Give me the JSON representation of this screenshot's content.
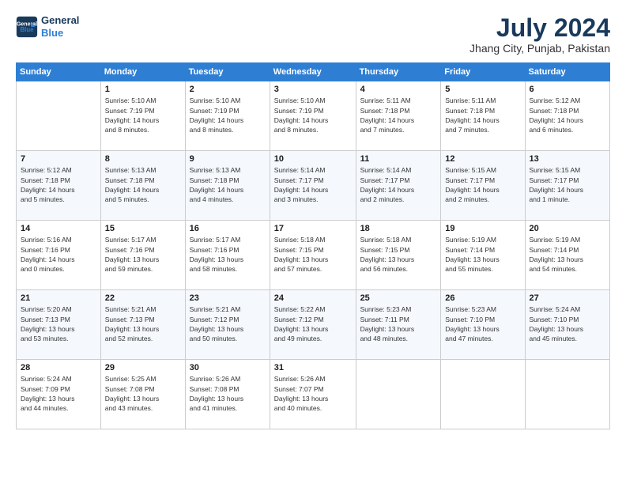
{
  "header": {
    "logo_line1": "General",
    "logo_line2": "Blue",
    "month": "July 2024",
    "location": "Jhang City, Punjab, Pakistan"
  },
  "days_of_week": [
    "Sunday",
    "Monday",
    "Tuesday",
    "Wednesday",
    "Thursday",
    "Friday",
    "Saturday"
  ],
  "weeks": [
    [
      {
        "day": "",
        "info": ""
      },
      {
        "day": "1",
        "info": "Sunrise: 5:10 AM\nSunset: 7:19 PM\nDaylight: 14 hours\nand 8 minutes."
      },
      {
        "day": "2",
        "info": "Sunrise: 5:10 AM\nSunset: 7:19 PM\nDaylight: 14 hours\nand 8 minutes."
      },
      {
        "day": "3",
        "info": "Sunrise: 5:10 AM\nSunset: 7:19 PM\nDaylight: 14 hours\nand 8 minutes."
      },
      {
        "day": "4",
        "info": "Sunrise: 5:11 AM\nSunset: 7:18 PM\nDaylight: 14 hours\nand 7 minutes."
      },
      {
        "day": "5",
        "info": "Sunrise: 5:11 AM\nSunset: 7:18 PM\nDaylight: 14 hours\nand 7 minutes."
      },
      {
        "day": "6",
        "info": "Sunrise: 5:12 AM\nSunset: 7:18 PM\nDaylight: 14 hours\nand 6 minutes."
      }
    ],
    [
      {
        "day": "7",
        "info": "Sunrise: 5:12 AM\nSunset: 7:18 PM\nDaylight: 14 hours\nand 5 minutes."
      },
      {
        "day": "8",
        "info": "Sunrise: 5:13 AM\nSunset: 7:18 PM\nDaylight: 14 hours\nand 5 minutes."
      },
      {
        "day": "9",
        "info": "Sunrise: 5:13 AM\nSunset: 7:18 PM\nDaylight: 14 hours\nand 4 minutes."
      },
      {
        "day": "10",
        "info": "Sunrise: 5:14 AM\nSunset: 7:17 PM\nDaylight: 14 hours\nand 3 minutes."
      },
      {
        "day": "11",
        "info": "Sunrise: 5:14 AM\nSunset: 7:17 PM\nDaylight: 14 hours\nand 2 minutes."
      },
      {
        "day": "12",
        "info": "Sunrise: 5:15 AM\nSunset: 7:17 PM\nDaylight: 14 hours\nand 2 minutes."
      },
      {
        "day": "13",
        "info": "Sunrise: 5:15 AM\nSunset: 7:17 PM\nDaylight: 14 hours\nand 1 minute."
      }
    ],
    [
      {
        "day": "14",
        "info": "Sunrise: 5:16 AM\nSunset: 7:16 PM\nDaylight: 14 hours\nand 0 minutes."
      },
      {
        "day": "15",
        "info": "Sunrise: 5:17 AM\nSunset: 7:16 PM\nDaylight: 13 hours\nand 59 minutes."
      },
      {
        "day": "16",
        "info": "Sunrise: 5:17 AM\nSunset: 7:16 PM\nDaylight: 13 hours\nand 58 minutes."
      },
      {
        "day": "17",
        "info": "Sunrise: 5:18 AM\nSunset: 7:15 PM\nDaylight: 13 hours\nand 57 minutes."
      },
      {
        "day": "18",
        "info": "Sunrise: 5:18 AM\nSunset: 7:15 PM\nDaylight: 13 hours\nand 56 minutes."
      },
      {
        "day": "19",
        "info": "Sunrise: 5:19 AM\nSunset: 7:14 PM\nDaylight: 13 hours\nand 55 minutes."
      },
      {
        "day": "20",
        "info": "Sunrise: 5:19 AM\nSunset: 7:14 PM\nDaylight: 13 hours\nand 54 minutes."
      }
    ],
    [
      {
        "day": "21",
        "info": "Sunrise: 5:20 AM\nSunset: 7:13 PM\nDaylight: 13 hours\nand 53 minutes."
      },
      {
        "day": "22",
        "info": "Sunrise: 5:21 AM\nSunset: 7:13 PM\nDaylight: 13 hours\nand 52 minutes."
      },
      {
        "day": "23",
        "info": "Sunrise: 5:21 AM\nSunset: 7:12 PM\nDaylight: 13 hours\nand 50 minutes."
      },
      {
        "day": "24",
        "info": "Sunrise: 5:22 AM\nSunset: 7:12 PM\nDaylight: 13 hours\nand 49 minutes."
      },
      {
        "day": "25",
        "info": "Sunrise: 5:23 AM\nSunset: 7:11 PM\nDaylight: 13 hours\nand 48 minutes."
      },
      {
        "day": "26",
        "info": "Sunrise: 5:23 AM\nSunset: 7:10 PM\nDaylight: 13 hours\nand 47 minutes."
      },
      {
        "day": "27",
        "info": "Sunrise: 5:24 AM\nSunset: 7:10 PM\nDaylight: 13 hours\nand 45 minutes."
      }
    ],
    [
      {
        "day": "28",
        "info": "Sunrise: 5:24 AM\nSunset: 7:09 PM\nDaylight: 13 hours\nand 44 minutes."
      },
      {
        "day": "29",
        "info": "Sunrise: 5:25 AM\nSunset: 7:08 PM\nDaylight: 13 hours\nand 43 minutes."
      },
      {
        "day": "30",
        "info": "Sunrise: 5:26 AM\nSunset: 7:08 PM\nDaylight: 13 hours\nand 41 minutes."
      },
      {
        "day": "31",
        "info": "Sunrise: 5:26 AM\nSunset: 7:07 PM\nDaylight: 13 hours\nand 40 minutes."
      },
      {
        "day": "",
        "info": ""
      },
      {
        "day": "",
        "info": ""
      },
      {
        "day": "",
        "info": ""
      }
    ]
  ]
}
